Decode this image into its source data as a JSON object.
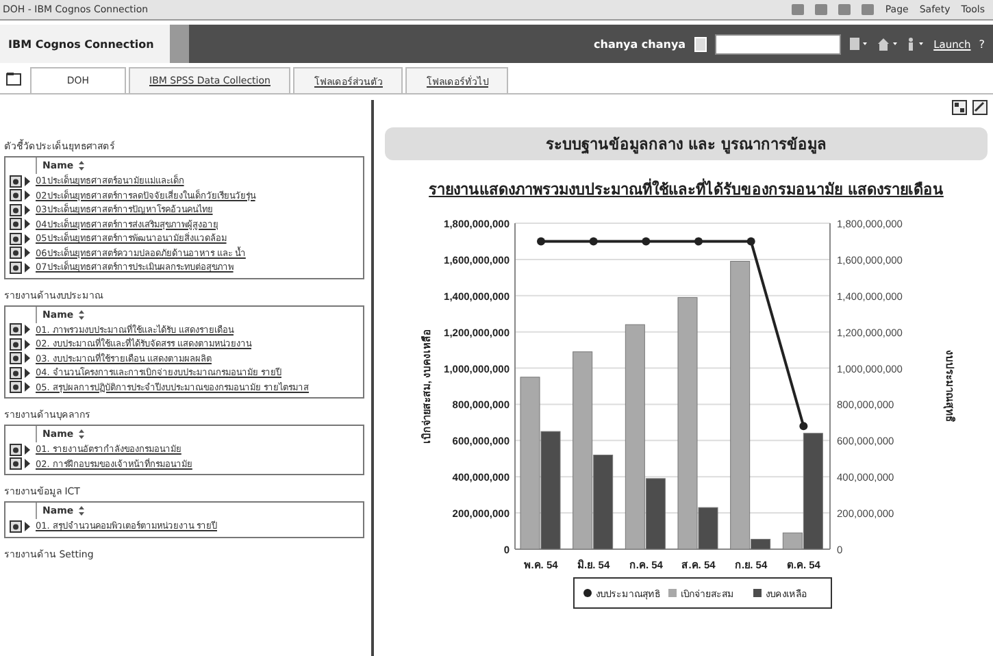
{
  "browser": {
    "title": "DOH - IBM Cognos Connection",
    "menus": [
      "Page",
      "Safety",
      "Tools"
    ]
  },
  "header": {
    "product": "IBM Cognos Connection",
    "user": "chanya chanya",
    "launch": "Launch",
    "help": "?"
  },
  "tabs": [
    {
      "label": "DOH",
      "selected": true
    },
    {
      "label": "IBM SPSS Data Collection",
      "selected": false
    },
    {
      "label": "โฟลเดอร์ส่วนตัว",
      "selected": false
    },
    {
      "label": "โฟลเดอร์ทั่วไป",
      "selected": false
    }
  ],
  "sections": [
    {
      "title": "ตัวชี้วัดประเด็นยุทธศาสตร์",
      "column": "Name",
      "items": [
        "01ประเด็นยุทธศาสตร์อนามัยแม่และเด็ก",
        "02ประเด็นยุทธศาสตร์การลดปัจจัยเสี่ยงในเด็กวัยเรียนวัยรุ่น",
        "03ประเด็นยุทธศาสตร์การปัญหาโรคอ้วนคนไทย",
        "04ประเด็นยุทธศาสตร์การส่งเสริมสุขภาพผู้สูงอายุ",
        "05ประเด็นยุทธศาสตร์การพัฒนาอนามัยสิ่งแวดล้อม",
        "06ประเด็นยุทธศาสตร์ความปลอดภัยด้านอาหาร และ น้ำ",
        "07ประเด็นยุทธศาสตร์การประเมินผลกระทบต่อสุขภาพ"
      ]
    },
    {
      "title": "รายงานด้านงบประมาณ",
      "column": "Name",
      "items": [
        "01. ภาพรวมงบประมาณที่ใช้และได้รับ แสดงรายเดือน",
        "02. งบประมาณที่ใช้และที่ได้รับจัดสรร แสดงตามหน่วยงาน",
        "03. งบประมาณที่ใช้รายเดือน แสดงตามผลผลิต",
        "04. จำนวนโครงการและการเบิกจ่ายงบประมาณกรมอนามัย รายปี",
        "05. สรุปผลการปฏิบัติการประจำปีงบประมาณของกรมอนามัย รายไตรมาส"
      ]
    },
    {
      "title": "รายงานด้านบุคลากร",
      "column": "Name",
      "items": [
        "01. รายงานอัตรากำลังของกรมอนามัย",
        "02. การฝึกอบรมของเจ้าหน้าที่กรมอนามัย"
      ]
    },
    {
      "title": "รายงานข้อมูล ICT",
      "column": "Name",
      "items": [
        "01. สรุปจำนวนคอมพิวเตอร์ตามหน่วยงาน รายปี"
      ]
    },
    {
      "title": "รายงานด้าน Setting"
    }
  ],
  "banner": "ระบบฐานข้อมูลกลาง และ บูรณาการข้อมูล",
  "report_title": "รายงานแสดงภาพรวมงบประมาณที่ใช้และที่ได้รับของกรมอนามัย แสดงรายเดือน",
  "chart_data": {
    "type": "bar",
    "ylabel": "เบิกจ่ายสะสม, งบคงเหลือ",
    "y2label": "งบประมาณสุทธิ",
    "categories": [
      "พ.ค. 54",
      "มิ.ย. 54",
      "ก.ค. 54",
      "ส.ค. 54",
      "ก.ย. 54",
      "ต.ค. 54"
    ],
    "stacked": false,
    "grid": true,
    "legend": "bottom",
    "series": [
      {
        "name": "งบประมาณสุทธิ",
        "type": "line",
        "marker": true,
        "color": "#222222",
        "values": [
          1700000000,
          1700000000,
          1700000000,
          1700000000,
          1700000000,
          680000000
        ]
      },
      {
        "name": "เบิกจ่ายสะสม",
        "color": "#a9a9a9",
        "values": [
          950000000,
          1090000000,
          1240000000,
          1390000000,
          1590000000,
          90000000
        ]
      },
      {
        "name": "งบคงเหลือ",
        "color": "#4d4d4d",
        "values": [
          650000000,
          520000000,
          390000000,
          230000000,
          55000000,
          640000000
        ]
      }
    ],
    "ylim": [
      0,
      1800000000
    ],
    "y2lim": [
      0,
      1800000000
    ],
    "yticks": [
      {
        "value": 0,
        "label": "0"
      },
      {
        "value": 200000000,
        "label": "200,000,000"
      },
      {
        "value": 400000000,
        "label": "400,000,000"
      },
      {
        "value": 600000000,
        "label": "600,000,000"
      },
      {
        "value": 800000000,
        "label": "800,000,000"
      },
      {
        "value": 1000000000,
        "label": "1,000,000,000"
      },
      {
        "value": 1200000000,
        "label": "1,200,000,000"
      },
      {
        "value": 1400000000,
        "label": "1,400,000,000"
      },
      {
        "value": 1600000000,
        "label": "1,600,000,000"
      },
      {
        "value": 1800000000,
        "label": "1,800,000,000"
      }
    ],
    "y2ticks": [
      {
        "value": 0,
        "label": "0"
      },
      {
        "value": 200000000,
        "label": "200,000,000"
      },
      {
        "value": 400000000,
        "label": "400,000,000"
      },
      {
        "value": 600000000,
        "label": "600,000,000"
      },
      {
        "value": 800000000,
        "label": "800,000,000"
      },
      {
        "value": 1000000000,
        "label": "1,000,000,000"
      },
      {
        "value": 1200000000,
        "label": "1,200,000,000"
      },
      {
        "value": 1400000000,
        "label": "1,400,000,000"
      },
      {
        "value": 1600000000,
        "label": "1,600,000,000"
      },
      {
        "value": 1800000000,
        "label": "1,800,000,000"
      }
    ]
  }
}
